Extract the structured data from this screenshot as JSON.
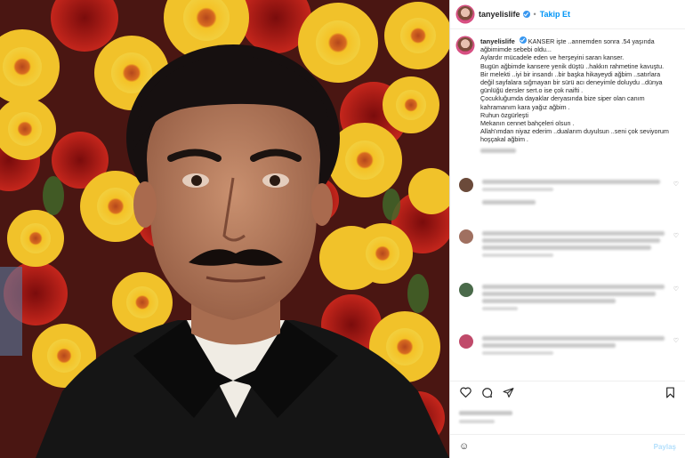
{
  "header": {
    "username": "tanyelislife",
    "follow_label": "Takip Et",
    "separator": "•"
  },
  "caption": {
    "username": "tanyelislife",
    "lines": [
      "KANSER işte ..annemden sonra .54 yaşında",
      "ağbimimde sebebi oldu...",
      "Aylardır mücadele eden ve herşeyini saran kanser.",
      "Bugün ağbimde kansere yenik düştü ..hakkın rahmetine kavuştu.",
      "Bir melekti ..iyi bir insandı ..bir başka hikayeydi ağbim ..satırlara",
      "değil sayfalara sığmayan bir sürü acı deneyimle doluydu ..dünya",
      "günlüğü dersler sert.o ise çok naifti .",
      "Çocukluğumda dayaklar deryasında bize siper olan canım",
      "kahramanım kara yağız ağbim .",
      "Ruhun özgürleşti",
      "Mekanın cennet bahçeleri olsun .",
      "Allah'ımdan niyaz ederim ..dualarım duyulsun ..seni çok seviyorum",
      "hoşçakal ağbim ."
    ]
  },
  "comment_colors": [
    "#6b4a3a",
    "#a07060",
    "#4a6a4a",
    "#c04a6a"
  ],
  "icons": {
    "like": "heart-icon",
    "comment": "comment-icon",
    "share": "share-icon",
    "save": "bookmark-icon",
    "emoji": "smile-icon"
  },
  "add_comment": {
    "post_label": "Paylaş"
  }
}
